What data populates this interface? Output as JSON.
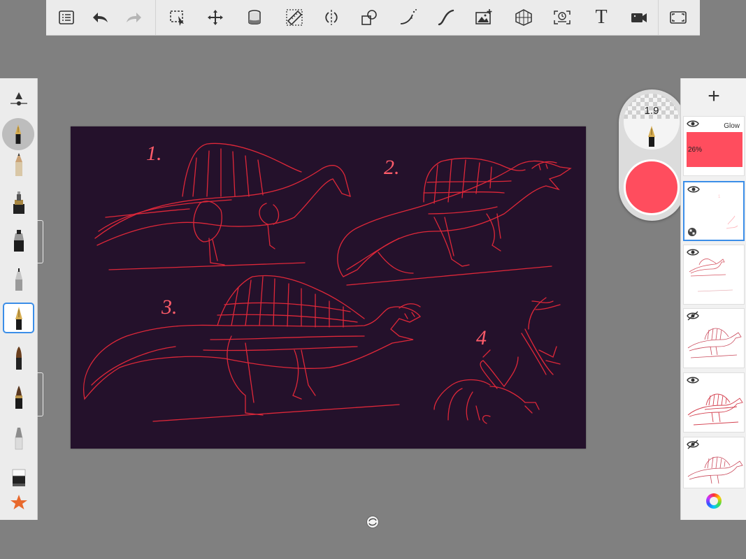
{
  "toolbar": {
    "tools": [
      {
        "icon": "list-icon"
      },
      {
        "icon": "undo-icon"
      },
      {
        "icon": "redo-icon"
      },
      {
        "icon": "selection-icon"
      },
      {
        "icon": "transform-icon"
      },
      {
        "icon": "fill-bucket-icon"
      },
      {
        "icon": "ruler-icon"
      },
      {
        "icon": "symmetry-icon"
      },
      {
        "icon": "shape-icon"
      },
      {
        "icon": "perspective-guide-icon"
      },
      {
        "icon": "stroke-icon"
      },
      {
        "icon": "add-image-icon"
      },
      {
        "icon": "perspective-grid-icon"
      },
      {
        "icon": "time-lapse-icon"
      },
      {
        "icon": "text-icon",
        "label": "T"
      },
      {
        "icon": "video-icon"
      },
      {
        "icon": "fullscreen-icon"
      }
    ]
  },
  "brush_puck": {
    "size": "1.9",
    "color": "#ff4d5e"
  },
  "layers": {
    "glow_layer": {
      "name": "Glow",
      "opacity": "26%"
    }
  },
  "canvas": {
    "background": "#24112b",
    "labels": [
      "1.",
      "2.",
      "3.",
      "4"
    ]
  },
  "colors": {
    "accent": "#3b8ee8",
    "sketch": "#e8293a"
  }
}
